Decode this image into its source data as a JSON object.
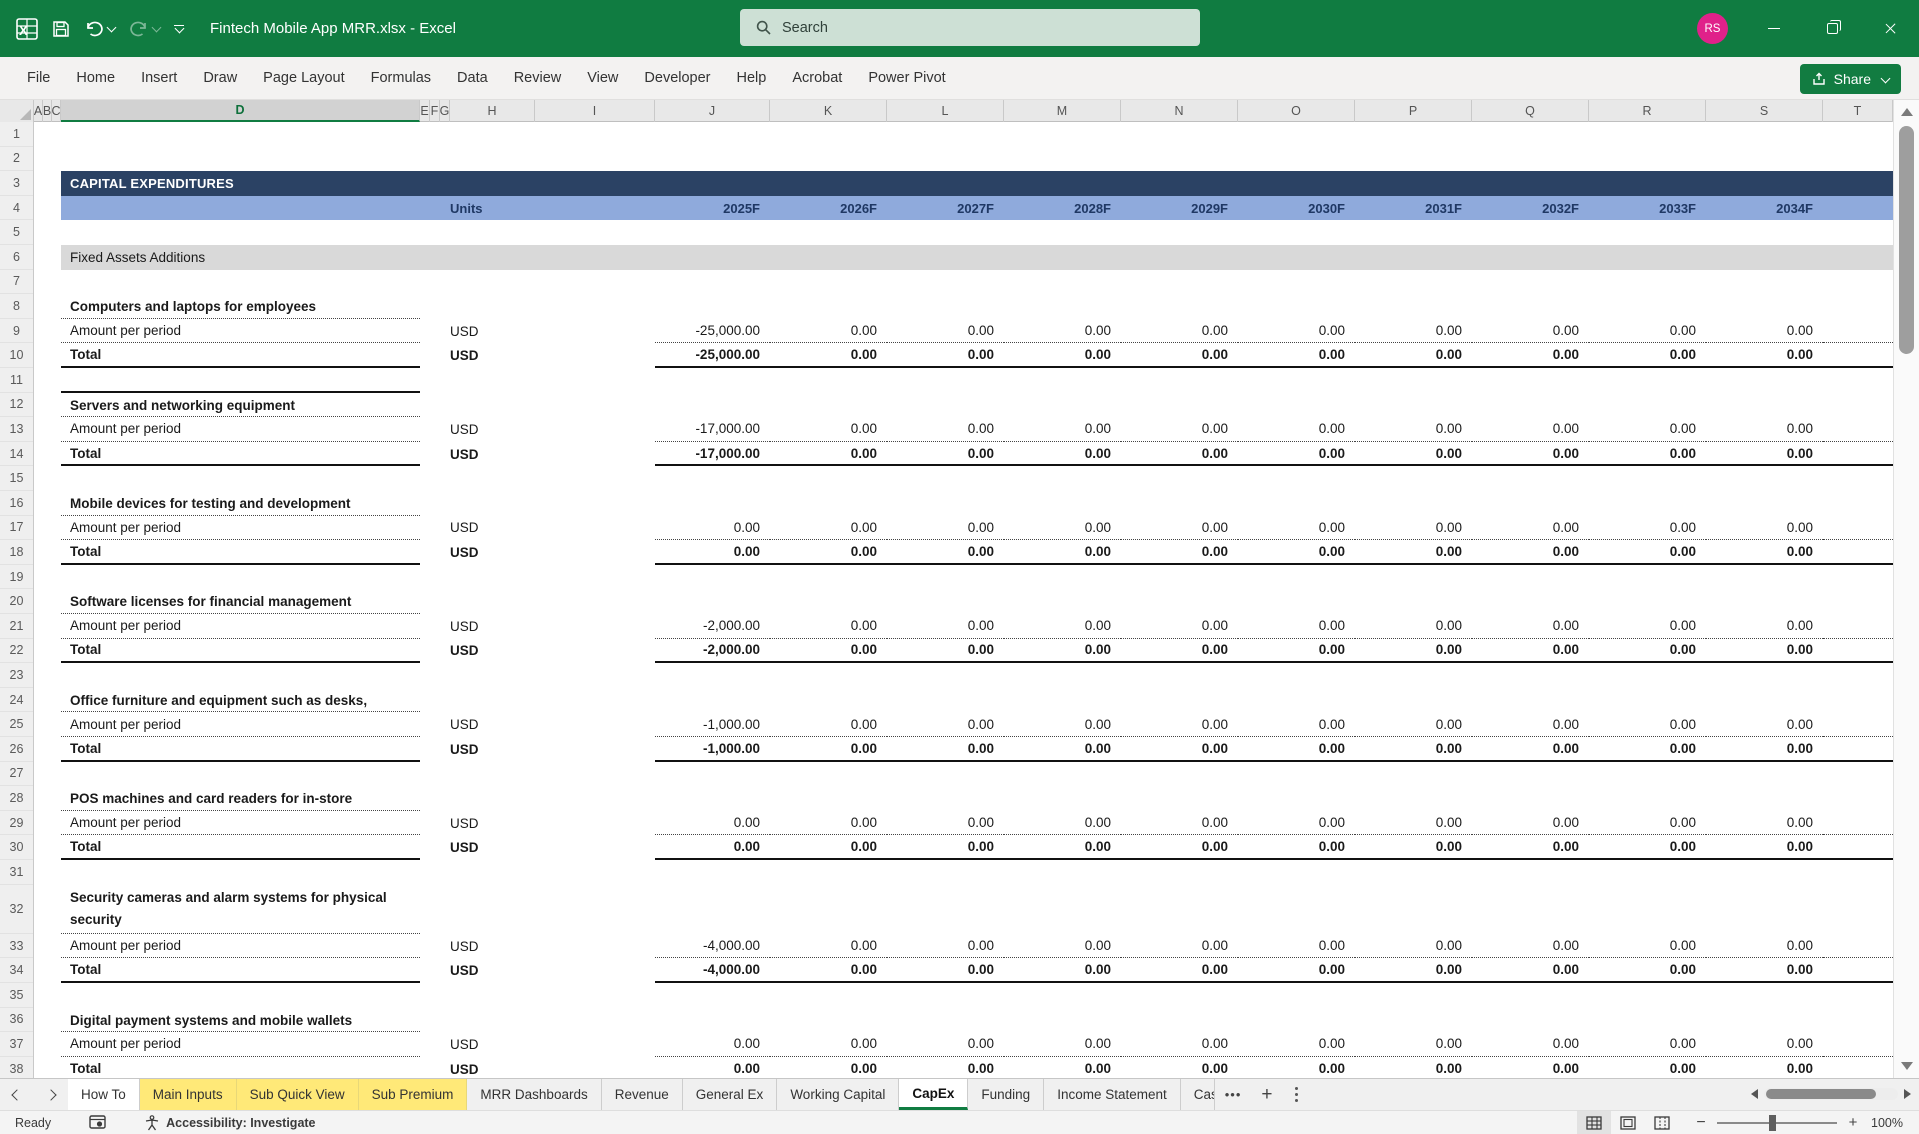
{
  "colors": {
    "excel_green": "#107C41",
    "header_navy": "#2B4264",
    "header_blue": "#8FAADC",
    "band_gray": "#D9D9D9",
    "tab_yellow": "#FFE978",
    "avatar_pink": "#E0218A"
  },
  "title_bar": {
    "title": "Fintech Mobile App MRR.xlsx  -  Excel",
    "search_placeholder": "Search",
    "avatar_initials": "RS"
  },
  "ribbon": {
    "tabs": [
      "File",
      "Home",
      "Insert",
      "Draw",
      "Page Layout",
      "Formulas",
      "Data",
      "Review",
      "View",
      "Developer",
      "Help",
      "Acrobat",
      "Power Pivot"
    ],
    "share_label": "Share"
  },
  "grid": {
    "column_letters": [
      "A",
      "B",
      "C",
      "D",
      "E",
      "F",
      "G",
      "H",
      "I",
      "J",
      "K",
      "L",
      "M",
      "N",
      "O",
      "P",
      "Q",
      "R",
      "S",
      "T"
    ],
    "selected_column": "D",
    "row_numbers": [
      1,
      2,
      3,
      4,
      5,
      6,
      7,
      8,
      9,
      10,
      11,
      12,
      13,
      14,
      15,
      16,
      17,
      18,
      19,
      20,
      21,
      22,
      23,
      24,
      25,
      26,
      27,
      28,
      29,
      30,
      31,
      32,
      33,
      34,
      35,
      36,
      37,
      38
    ]
  },
  "sheet": {
    "section_header": "CAPITAL EXPENDITURES",
    "units_label": "Units",
    "years": [
      "2025F",
      "2026F",
      "2027F",
      "2028F",
      "2029F",
      "2030F",
      "2031F",
      "2032F",
      "2033F",
      "2034F"
    ],
    "group_header": "Fixed Assets Additions",
    "labels": {
      "amount": "Amount per period",
      "total": "Total",
      "unit": "USD"
    },
    "sections": [
      {
        "title": "Computers and laptops for employees",
        "values": [
          "-25,000.00",
          "0.00",
          "0.00",
          "0.00",
          "0.00",
          "0.00",
          "0.00",
          "0.00",
          "0.00",
          "0.00"
        ]
      },
      {
        "title": "Servers and networking equipment",
        "values": [
          "-17,000.00",
          "0.00",
          "0.00",
          "0.00",
          "0.00",
          "0.00",
          "0.00",
          "0.00",
          "0.00",
          "0.00"
        ]
      },
      {
        "title": "Mobile devices for testing and development",
        "values": [
          "0.00",
          "0.00",
          "0.00",
          "0.00",
          "0.00",
          "0.00",
          "0.00",
          "0.00",
          "0.00",
          "0.00"
        ]
      },
      {
        "title": "Software licenses for financial management",
        "values": [
          "-2,000.00",
          "0.00",
          "0.00",
          "0.00",
          "0.00",
          "0.00",
          "0.00",
          "0.00",
          "0.00",
          "0.00"
        ]
      },
      {
        "title": "Office furniture and equipment such as desks,",
        "values": [
          "-1,000.00",
          "0.00",
          "0.00",
          "0.00",
          "0.00",
          "0.00",
          "0.00",
          "0.00",
          "0.00",
          "0.00"
        ]
      },
      {
        "title": "POS machines and card readers for in-store",
        "values": [
          "0.00",
          "0.00",
          "0.00",
          "0.00",
          "0.00",
          "0.00",
          "0.00",
          "0.00",
          "0.00",
          "0.00"
        ]
      },
      {
        "title": "Security cameras and alarm systems for physical security",
        "values": [
          "-4,000.00",
          "0.00",
          "0.00",
          "0.00",
          "0.00",
          "0.00",
          "0.00",
          "0.00",
          "0.00",
          "0.00"
        ]
      },
      {
        "title": "Digital payment systems and mobile wallets",
        "values": [
          "0.00",
          "0.00",
          "0.00",
          "0.00",
          "0.00",
          "0.00",
          "0.00",
          "0.00",
          "0.00",
          "0.00"
        ]
      }
    ]
  },
  "sheet_tabs": {
    "tabs": [
      {
        "label": "How To",
        "style": "white"
      },
      {
        "label": "Main Inputs",
        "style": "yellow"
      },
      {
        "label": "Sub Quick View",
        "style": "yellow"
      },
      {
        "label": "Sub Premium",
        "style": "yellow"
      },
      {
        "label": "MRR Dashboards",
        "style": "plain"
      },
      {
        "label": "Revenue",
        "style": "plain"
      },
      {
        "label": "General Ex",
        "style": "plain"
      },
      {
        "label": "Working Capital",
        "style": "plain"
      },
      {
        "label": "CapEx",
        "style": "active"
      },
      {
        "label": "Funding",
        "style": "plain"
      },
      {
        "label": "Income Statement",
        "style": "plain"
      },
      {
        "label": "Cas",
        "style": "clipped"
      }
    ]
  },
  "status_bar": {
    "ready": "Ready",
    "accessibility": "Accessibility: Investigate",
    "zoom_percent": "100%"
  }
}
